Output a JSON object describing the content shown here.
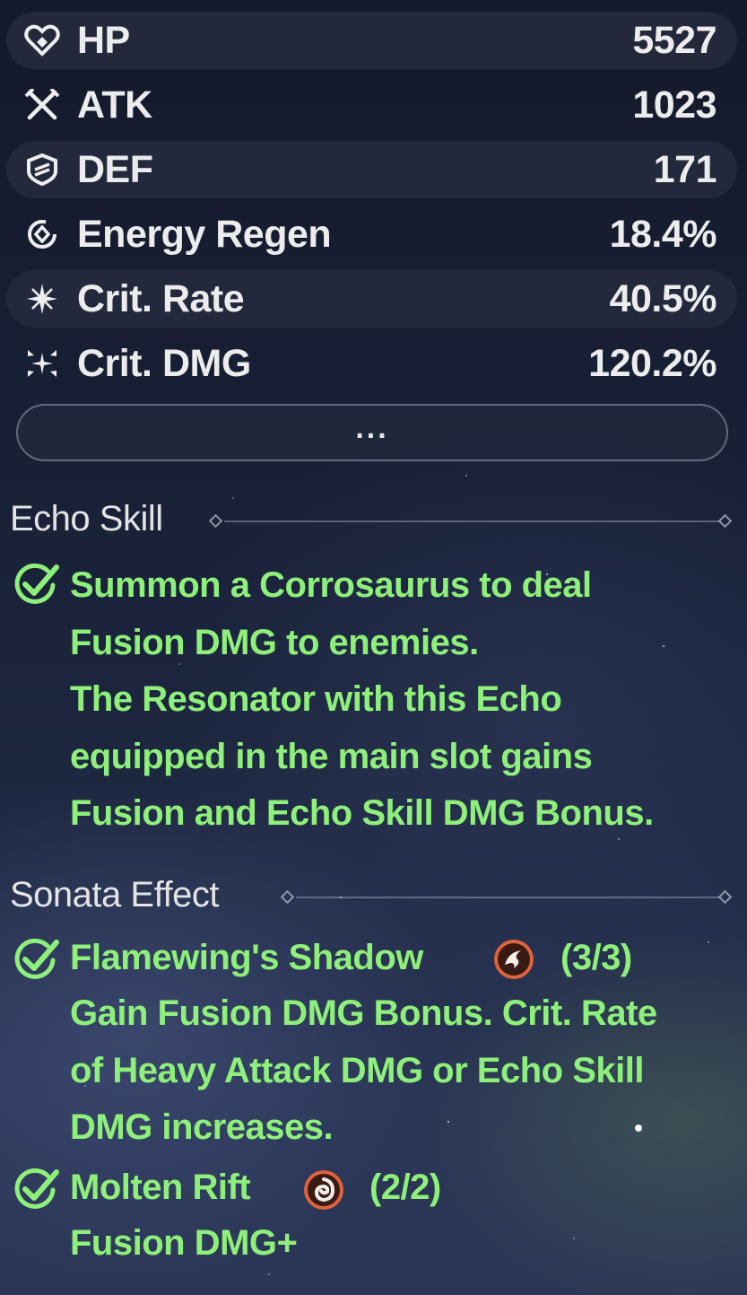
{
  "stats": [
    {
      "label": "HP",
      "value": "5527",
      "icon": "heart-icon"
    },
    {
      "label": "ATK",
      "value": "1023",
      "icon": "crossed-swords-icon"
    },
    {
      "label": "DEF",
      "value": "171",
      "icon": "shield-icon"
    },
    {
      "label": "Energy Regen",
      "value": "18.4%",
      "icon": "energy-regen-icon"
    },
    {
      "label": "Crit. Rate",
      "value": "40.5%",
      "icon": "crit-rate-star-icon"
    },
    {
      "label": "Crit. DMG",
      "value": "120.2%",
      "icon": "crit-dmg-burst-icon"
    }
  ],
  "more_button": {
    "label": "..."
  },
  "echo_skill": {
    "title": "Echo Skill",
    "lines": [
      "Summon a Corrosaurus to deal",
      "Fusion DMG to enemies.",
      "The Resonator with this Echo",
      "equipped in the main slot gains",
      "Fusion and Echo Skill DMG Bonus."
    ]
  },
  "sonata_effect": {
    "title": "Sonata Effect",
    "sets": [
      {
        "name": "Flamewing's Shadow",
        "count": "(3/3)",
        "icon": "flamewing-icon",
        "lines": [
          "Gain Fusion DMG Bonus. Crit. Rate",
          "of Heavy Attack DMG or Echo Skill",
          "DMG increases."
        ]
      },
      {
        "name": "Molten Rift",
        "count": "(2/2)",
        "icon": "molten-rift-icon",
        "lines": [
          "Fusion DMG+"
        ]
      }
    ]
  },
  "colors": {
    "accent_green": "#8ef07a",
    "stat_text": "#ececec",
    "row_shade": "#262c3e",
    "sonata_icon_ring": "#e0633c"
  }
}
